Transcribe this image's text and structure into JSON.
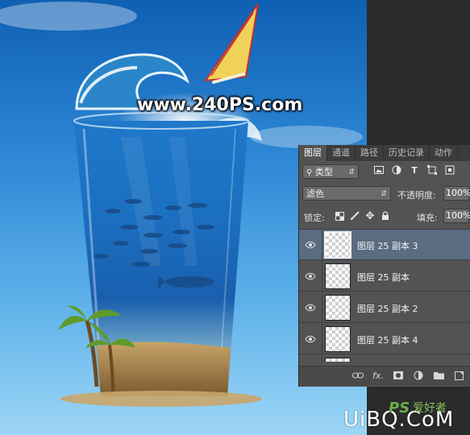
{
  "artwork": {
    "watermark_text": "www.240PS.com"
  },
  "layers_panel": {
    "tabs": [
      {
        "label": "图层",
        "active": true
      },
      {
        "label": "通道",
        "active": false
      },
      {
        "label": "路径",
        "active": false
      },
      {
        "label": "历史记录",
        "active": false
      },
      {
        "label": "动作",
        "active": false
      }
    ],
    "filter": {
      "selected": "类型",
      "icons": [
        "image-filter-icon",
        "adjustment-filter-icon",
        "text-filter-icon",
        "shape-filter-icon",
        "smart-object-filter-icon"
      ]
    },
    "blend_mode": "滤色",
    "opacity_label": "不透明度:",
    "opacity_value": "100%",
    "lock_label": "锁定:",
    "lock_icons": [
      "lock-transparent-icon",
      "lock-paint-icon",
      "lock-move-icon",
      "lock-all-icon"
    ],
    "fill_label": "填充:",
    "fill_value": "100%",
    "layers": [
      {
        "name": "图层 25 副本 3",
        "visible": true,
        "selected": true
      },
      {
        "name": "图层 25 副本",
        "visible": true,
        "selected": false
      },
      {
        "name": "图层 25 副本 2",
        "visible": true,
        "selected": false
      },
      {
        "name": "图层 25 副本 4",
        "visible": true,
        "selected": false
      }
    ],
    "bottom_icons": [
      "link-layers-icon",
      "fx-icon",
      "add-mask-icon",
      "adjustment-layer-icon",
      "new-group-icon",
      "new-layer-icon"
    ]
  },
  "footer_logo": {
    "text": "UiBQ.CoM",
    "ps_text": "PS",
    "chinese_text": "爱好者"
  },
  "colors": {
    "panel_bg": "#535353",
    "selected_layer": "#5a6c82",
    "sky_top": "#0f5fb3",
    "sky_bottom": "#9dd6f6"
  }
}
